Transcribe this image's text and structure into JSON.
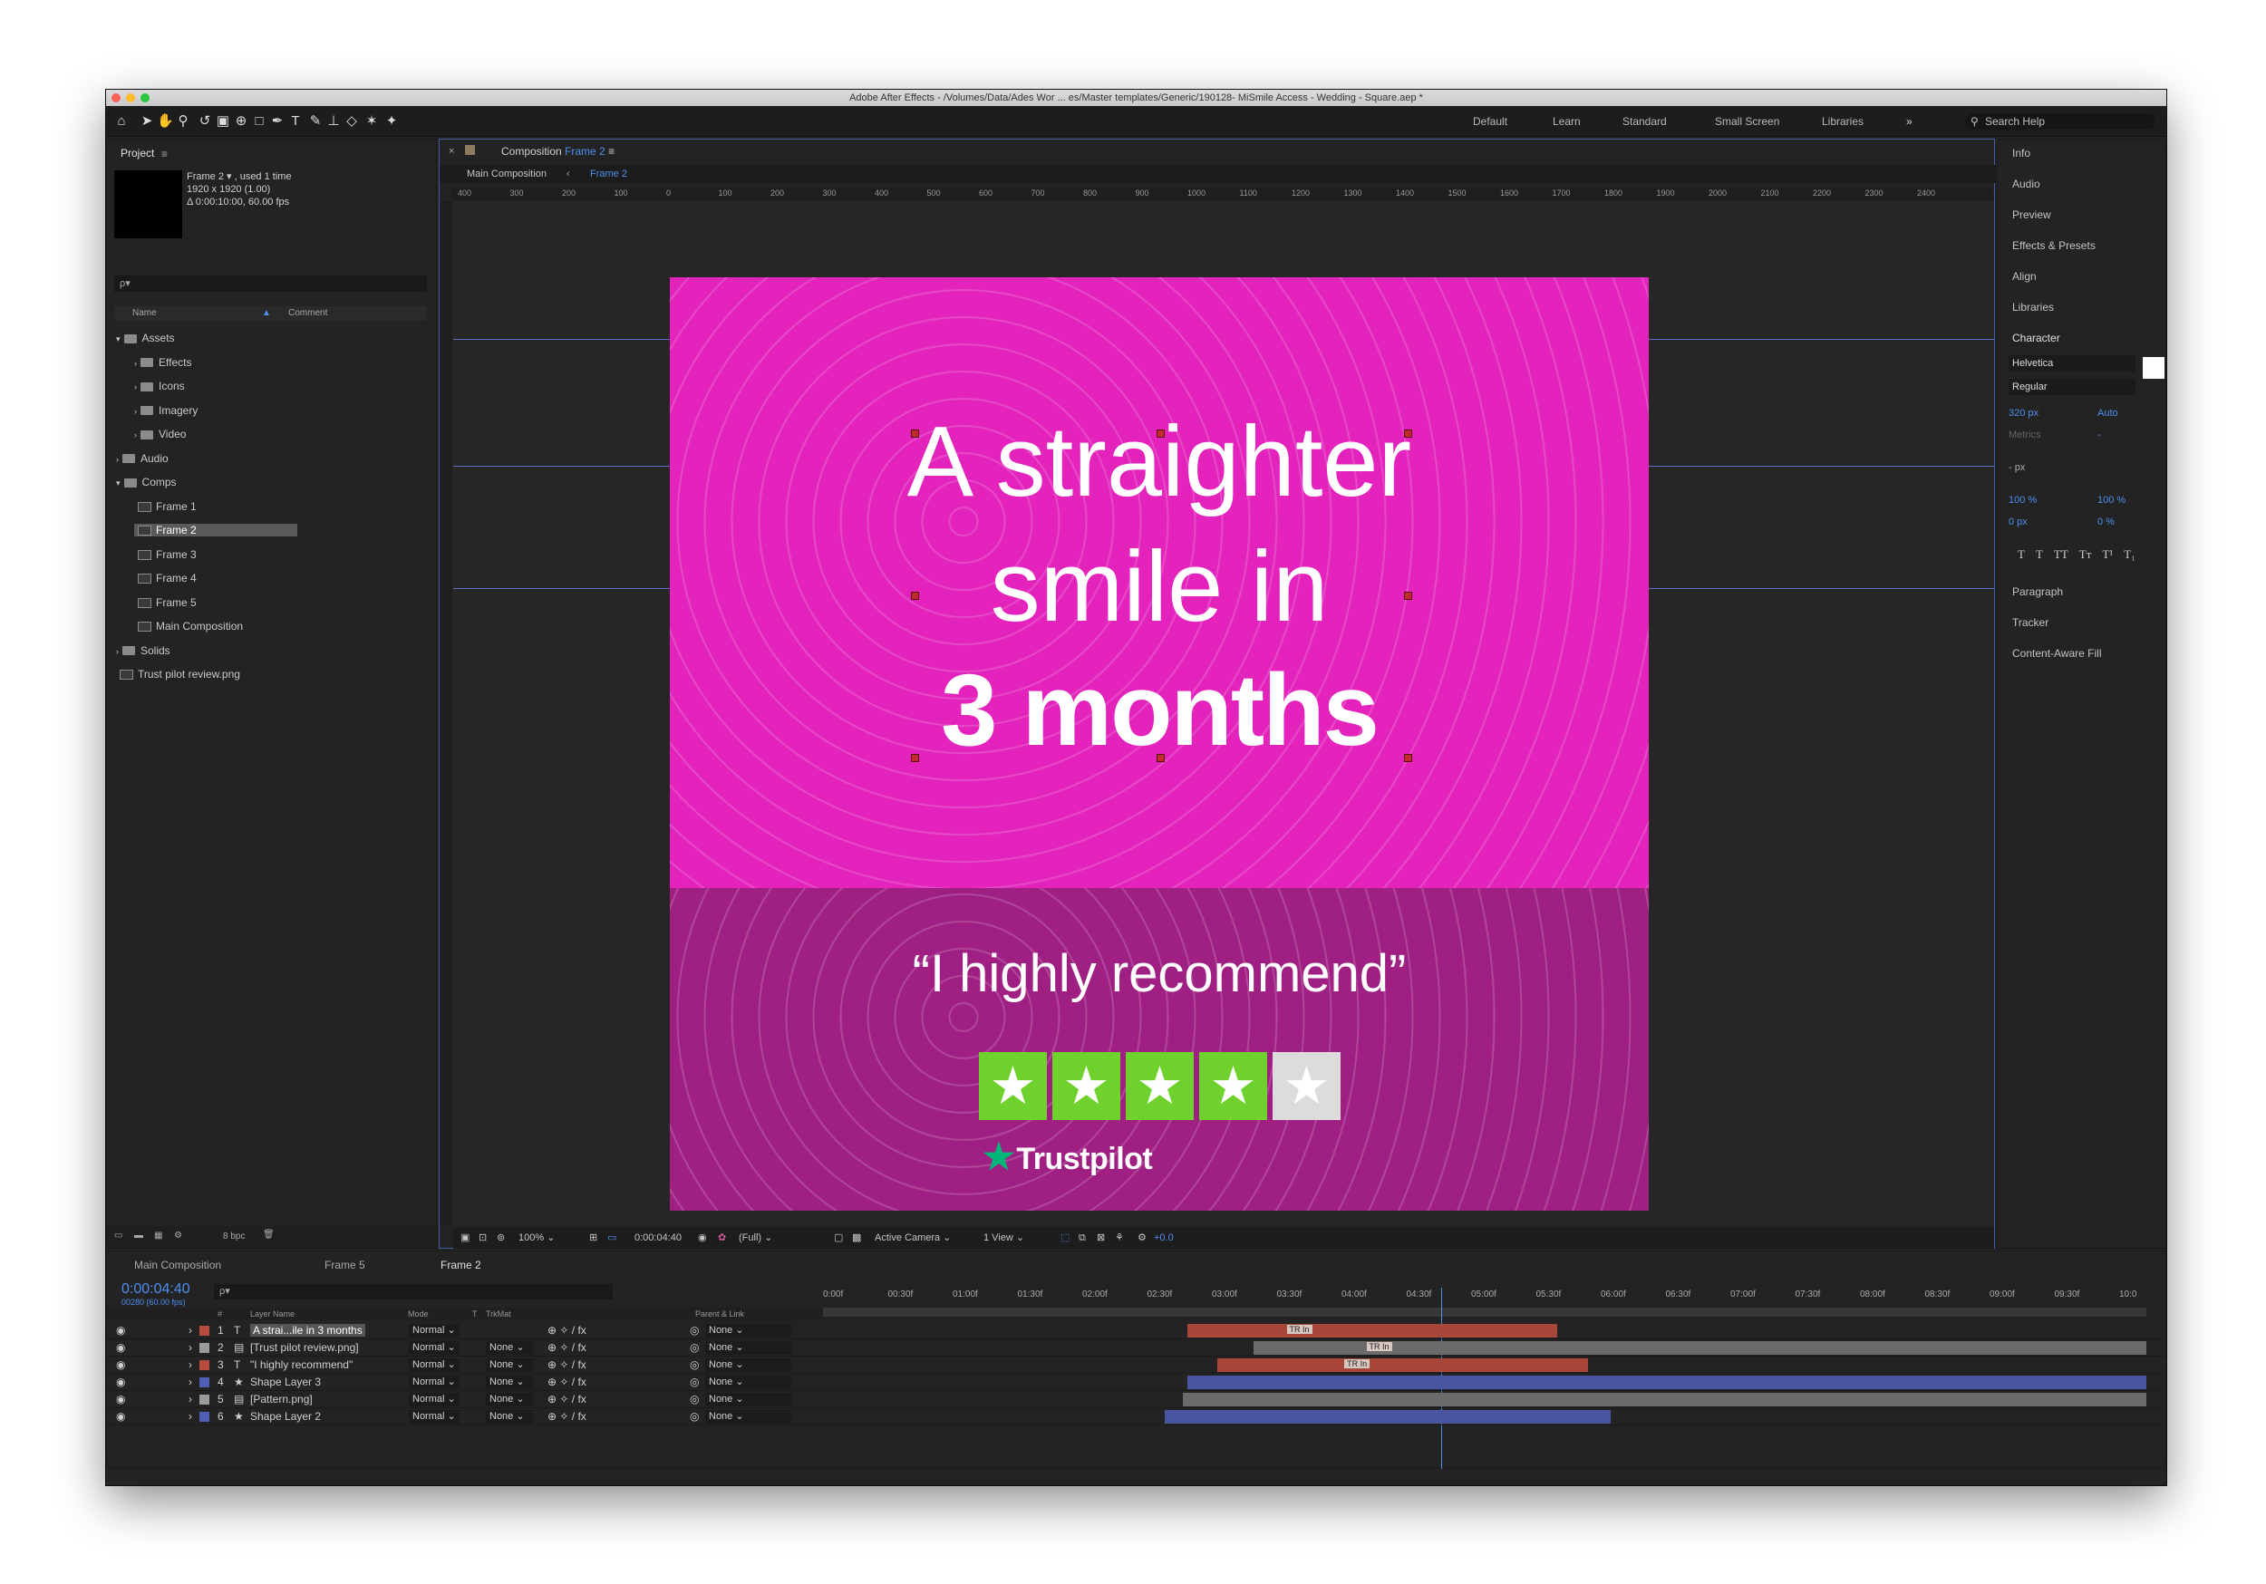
{
  "window": {
    "title": "Adobe After Effects - /Volumes/Data/Ades Wor ... es/Master templates/Generic/190128- MiSmile Access - Wedding - Square.aep *"
  },
  "workspaces": [
    "Default",
    "Learn",
    "Standard",
    "Small Screen",
    "Libraries"
  ],
  "search_help": "Search Help",
  "project": {
    "title": "Project",
    "selected_name": "Frame 2 ▾ , used 1 time",
    "selected_size": "1920 x 1920 (1.00)",
    "selected_duration": "Δ 0:00:10:00, 60.00 fps",
    "search_placeholder": "ρ▾",
    "col_name": "Name",
    "col_comment": "Comment",
    "tree": [
      {
        "label": "Assets",
        "type": "folder",
        "level": 0,
        "open": true
      },
      {
        "label": "Effects",
        "type": "folder",
        "level": 1
      },
      {
        "label": "Icons",
        "type": "folder",
        "level": 1
      },
      {
        "label": "Imagery",
        "type": "folder",
        "level": 1
      },
      {
        "label": "Video",
        "type": "folder",
        "level": 1
      },
      {
        "label": "Audio",
        "type": "folder",
        "level": 0
      },
      {
        "label": "Comps",
        "type": "folder",
        "level": 0,
        "open": true
      },
      {
        "label": "Frame 1",
        "type": "comp",
        "level": 1
      },
      {
        "label": "Frame 2",
        "type": "comp",
        "level": 1,
        "selected": true
      },
      {
        "label": "Frame 3",
        "type": "comp",
        "level": 1
      },
      {
        "label": "Frame 4",
        "type": "comp",
        "level": 1
      },
      {
        "label": "Frame 5",
        "type": "comp",
        "level": 1
      },
      {
        "label": "Main Composition",
        "type": "comp",
        "level": 1
      },
      {
        "label": "Solids",
        "type": "folder",
        "level": 0
      },
      {
        "label": "Trust pilot review.png",
        "type": "file",
        "level": 0
      }
    ],
    "bpc": "8 bpc"
  },
  "composition": {
    "tab_prefix": "Composition",
    "tab_name": "Frame 2",
    "crumb_main": "Main Composition",
    "crumb_current": "Frame 2",
    "ruler": [
      "400",
      "300",
      "200",
      "100",
      "0",
      "100",
      "200",
      "300",
      "400",
      "500",
      "600",
      "700",
      "800",
      "900",
      "1000",
      "1100",
      "1200",
      "1300",
      "1400",
      "1500",
      "1600",
      "1700",
      "1800",
      "1900",
      "2000",
      "2100",
      "2200",
      "2300",
      "2400"
    ],
    "headline1": "A straighter",
    "headline2": "smile in",
    "headline3": "3 months",
    "quote": "“I highly recommend”",
    "rating": 4,
    "rating_max": 5,
    "trustpilot": "Trustpilot",
    "footer": {
      "zoom": "100%",
      "time": "0:00:04:40",
      "quality": "(Full)",
      "camera": "Active Camera",
      "view": "1 View",
      "exposure": "+0.0"
    },
    "colors": {
      "top": "#e323bb",
      "bottom": "#a01f82",
      "star": "#6fd12c",
      "star_off": "#dcdcdc",
      "trustpilot": "#00b67a"
    }
  },
  "right_panels": {
    "items": [
      "Info",
      "Audio",
      "Preview",
      "Effects & Presets",
      "Align",
      "Libraries",
      "Character"
    ],
    "font": "Helvetica",
    "style": "Regular",
    "size": "320 px",
    "leading": "Auto",
    "kerning": "Metrics",
    "tracking": "-",
    "stroke": "- px",
    "vscale": "100 %",
    "hscale": "100 %",
    "baseline": "0 px",
    "tsume": "0 %",
    "type_buttons": [
      "T",
      "T",
      "TT",
      "Tт",
      "T¹",
      "T₁"
    ],
    "bottom_items": [
      "Paragraph",
      "Tracker",
      "Content-Aware Fill"
    ]
  },
  "timeline": {
    "tabs": [
      "Main Composition",
      "Frame 5",
      "Frame 2"
    ],
    "time": "0:00:04:40",
    "frame": "00280 (60.00 fps)",
    "search_placeholder": "ρ▾",
    "headers": {
      "num": "#",
      "name": "Layer Name",
      "mode": "Mode",
      "t": "T",
      "trkmat": "TrkMat",
      "parent": "Parent & Link"
    },
    "ruler": [
      "0:00f",
      "00:30f",
      "01:00f",
      "01:30f",
      "02:00f",
      "02:30f",
      "03:00f",
      "03:30f",
      "04:00f",
      "04:30f",
      "05:00f",
      "05:30f",
      "06:00f",
      "06:30f",
      "07:00f",
      "07:30f",
      "08:00f",
      "08:30f",
      "09:00f",
      "09:30f",
      "10:0"
    ],
    "layers": [
      {
        "num": "1",
        "name": "A strai...ile in  3 months",
        "type": "T",
        "mode": "Normal",
        "trkmat": "",
        "parent": "None",
        "label_color": "#b64a3c",
        "bar": "#a9463a",
        "start": 0.275,
        "end": 0.555,
        "marker": "TR In"
      },
      {
        "num": "2",
        "name": "[Trust pilot review.png]",
        "type": "img",
        "mode": "Normal",
        "trkmat": "None",
        "parent": "None",
        "label_color": "#9a9a9a",
        "bar": "#6b6b6b",
        "start": 0.325,
        "end": 1.0,
        "marker": "TR In"
      },
      {
        "num": "3",
        "name": "\"I highly recommend\"",
        "type": "T",
        "mode": "Normal",
        "trkmat": "None",
        "parent": "None",
        "label_color": "#b64a3c",
        "bar": "#a9463a",
        "start": 0.298,
        "end": 0.578,
        "marker": "TR In"
      },
      {
        "num": "4",
        "name": "Shape Layer 3",
        "type": "star",
        "mode": "Normal",
        "trkmat": "None",
        "parent": "None",
        "label_color": "#4f5fb3",
        "bar": "#4a55a0",
        "start": 0.275,
        "end": 1.0,
        "marker": ""
      },
      {
        "num": "5",
        "name": "[Pattern.png]",
        "type": "img",
        "mode": "Normal",
        "trkmat": "None",
        "parent": "None",
        "label_color": "#9a9a9a",
        "bar": "#6b6b6b",
        "start": 0.272,
        "end": 1.0,
        "marker": ""
      },
      {
        "num": "6",
        "name": "Shape Layer 2",
        "type": "star",
        "mode": "Normal",
        "trkmat": "None",
        "parent": "None",
        "label_color": "#4f5fb3",
        "bar": "#4a55a0",
        "start": 0.258,
        "end": 0.595,
        "marker": ""
      }
    ],
    "playhead": 0.467
  }
}
